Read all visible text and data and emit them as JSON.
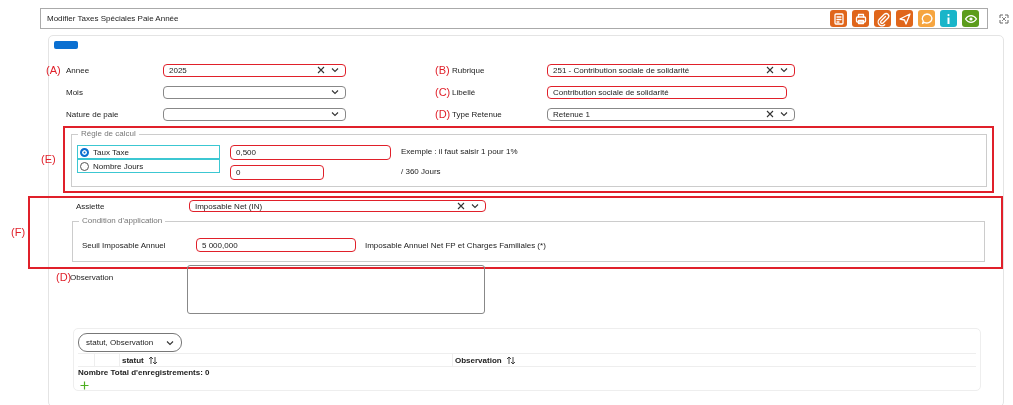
{
  "window": {
    "title": "Modifier Taxes Spéciales Paie Année"
  },
  "toolbar": [
    {
      "kind": "document",
      "color": "#e0661b"
    },
    {
      "kind": "print",
      "color": "#e0661b"
    },
    {
      "kind": "attach",
      "color": "#e0661b"
    },
    {
      "kind": "send",
      "color": "#e0661b"
    },
    {
      "kind": "comment",
      "color": "#f6a53f"
    },
    {
      "kind": "info",
      "color": "#19b5c9"
    },
    {
      "kind": "view",
      "color": "#5c9c1c"
    }
  ],
  "form": {
    "rows": [
      [
        {
          "marker": "(A)",
          "label": "Annee",
          "kind": "select",
          "value": "2025",
          "clearable": true,
          "highlighted": true
        },
        {
          "marker": "(B)",
          "label": "Rubrique",
          "kind": "select",
          "value": "251 - Contribution sociale de solidarité",
          "clearable": true,
          "highlighted": true
        }
      ],
      [
        {
          "label": "Mois",
          "kind": "select",
          "clearable": false,
          "highlighted": false
        },
        {
          "marker": "(C)",
          "label": "Libellé",
          "kind": "text",
          "value": "Contribution sociale de solidarité",
          "highlighted": true
        }
      ],
      [
        {
          "label": "Nature de paie",
          "kind": "select",
          "clearable": false,
          "highlighted": false
        },
        {
          "marker": "(D)",
          "label": "Type Retenue",
          "kind": "select",
          "value": "Retenue 1",
          "clearable": true,
          "highlighted": false
        }
      ]
    ]
  },
  "calc_rule": {
    "marker": "(E)",
    "legend": "Régle de calcul",
    "options": [
      {
        "label": "Taux Taxe",
        "selected": true,
        "value": "0,500",
        "highlighted": true,
        "hint": "Exemple : il faut saisir 1 pour 1%"
      },
      {
        "label": "Nombre Jours",
        "selected": false,
        "value": "0",
        "highlighted": true,
        "hint": "/ 360 Jours"
      }
    ]
  },
  "base_section": {
    "marker": "(F)",
    "assiette": {
      "label": "Assiette",
      "value": "Imposable Net (IN)",
      "clearable": true,
      "highlighted": true
    },
    "condition": {
      "legend": "Condition d'application",
      "label": "Seuil Imposable Annuel",
      "value": "5 000,000",
      "highlighted": true,
      "hint": "Imposable Annuel Net FP et Charges Familiales (*)"
    }
  },
  "observation": {
    "marker": "(D)",
    "label": "Observation"
  },
  "table": {
    "column_chooser": "statut, Observation",
    "columns": [
      {
        "label": "statut"
      },
      {
        "label": "Observation"
      }
    ],
    "total": "Nombre Total d'enregistrements: 0"
  }
}
